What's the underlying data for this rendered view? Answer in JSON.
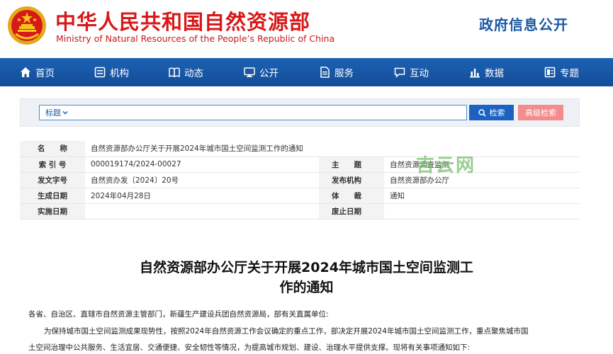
{
  "header": {
    "site_title": "中华人民共和国自然资源部",
    "site_subtitle": "Ministry of Natural Resources of the People’s Republic of China",
    "portal_title": "政府信息公开",
    "colors": {
      "brand_red": "#d8191a",
      "brand_blue": "#1b58a5"
    }
  },
  "nav": {
    "items": [
      {
        "label": "首页",
        "icon": "home-icon"
      },
      {
        "label": "机构",
        "icon": "org-icon"
      },
      {
        "label": "动态",
        "icon": "book-icon"
      },
      {
        "label": "公开",
        "icon": "monitor-icon"
      },
      {
        "label": "服务",
        "icon": "document-icon"
      },
      {
        "label": "互动",
        "icon": "chat-icon"
      },
      {
        "label": "数据",
        "icon": "bar-chart-icon"
      },
      {
        "label": "专题",
        "icon": "topic-icon"
      }
    ]
  },
  "search": {
    "scope_label": "标题",
    "value": "",
    "search_label": "检索",
    "advanced_label": "高级检索"
  },
  "meta": {
    "name_label": "名　　称",
    "name_value": "自然资源部办公厅关于开展2024年城市国土空间监测工作的通知",
    "index_label": "索 引 号",
    "index_value": "000019174/2024-00027",
    "topic_label": "主　　题",
    "topic_value": "自然资源调查监测",
    "doc_no_label": "发文字号",
    "doc_no_value": "自然资办发〔2024〕20号",
    "issuer_label": "发布机构",
    "issuer_value": "自然资源部办公厅",
    "date_label": "生成日期",
    "date_value": "2024年04月28日",
    "genre_label": "体　　裁",
    "genre_value": "通知",
    "effective_label": "实施日期",
    "effective_value": "",
    "expire_label": "废止日期",
    "expire_value": ""
  },
  "watermark": "吉云网",
  "article": {
    "title_line1": "自然资源部办公厅关于开展2024年城市国土空间监测工",
    "title_line2": "作的通知",
    "salutation": "各省、自治区、直辖市自然资源主管部门，新疆生产建设兵团自然资源局，部有关直属单位:",
    "para1_line1": "为保持城市国土空间监测成果现势性，按照2024年自然资源工作会议确定的重点工作，部决定开展2024年城市国土空间监测工作，重点聚焦城市国",
    "para1_line2": "土空间治理中公共服务、生活宜居、交通便捷、安全韧性等情况，为提高城市规划、建设、治理水平提供支撑。现将有关事项通知如下:"
  }
}
